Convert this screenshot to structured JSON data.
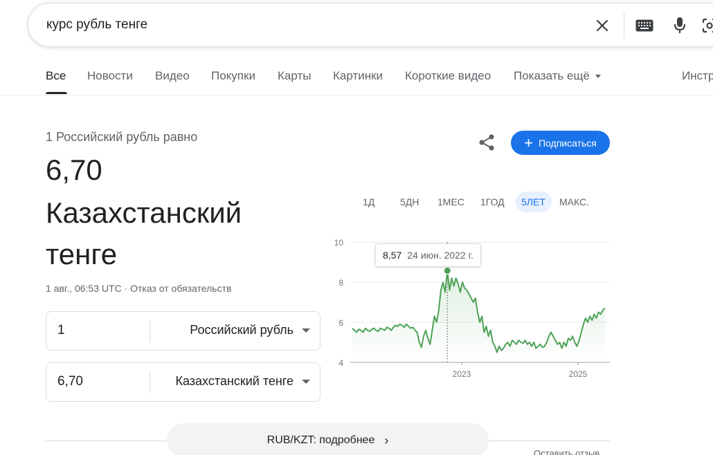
{
  "search": {
    "query": "курс рубль тенге"
  },
  "tabs": [
    {
      "label": "Все"
    },
    {
      "label": "Новости"
    },
    {
      "label": "Видео"
    },
    {
      "label": "Покупки"
    },
    {
      "label": "Карты"
    },
    {
      "label": "Картинки"
    },
    {
      "label": "Короткие видео"
    },
    {
      "label": "Показать ещё"
    },
    {
      "label": "Инстр"
    }
  ],
  "result": {
    "equals_text": "1 Российский рубль равно",
    "value": "6,70",
    "currency_name": "Казахстанский тенге",
    "timestamp": "1 авг., 06:53 UTC · Отказ от обязательств"
  },
  "converter": {
    "from": {
      "amount": "1",
      "currency": "Российский рубль"
    },
    "to": {
      "amount": "6,70",
      "currency": "Казахстанский тенге"
    }
  },
  "actions": {
    "subscribe_label": "Подписаться"
  },
  "ranges": [
    "1Д",
    "5ДН",
    "1МЕС",
    "1ГОД",
    "5ЛЕТ",
    "МАКС."
  ],
  "active_range": "5ЛЕТ",
  "tooltip": {
    "value": "8,57",
    "date": "24 июн. 2022 г."
  },
  "chart_data": {
    "type": "line",
    "ylim": [
      4,
      10
    ],
    "yticks": [
      "4",
      "6",
      "8",
      "10"
    ],
    "xticks": [
      "2023",
      "2025"
    ],
    "grid": true,
    "color": "#4ca256",
    "series": [
      {
        "values": [
          5.7,
          5.6,
          5.5,
          5.65,
          5.6,
          5.5,
          5.7,
          5.6,
          5.55,
          5.65,
          5.7,
          5.6,
          5.55,
          5.7,
          5.65,
          5.6,
          5.75,
          5.7,
          5.6,
          5.75,
          5.85,
          5.8,
          5.9,
          5.85,
          5.75,
          5.9,
          5.8,
          5.7,
          5.75,
          5.6,
          5.5,
          5.0,
          4.75,
          5.3,
          5.6,
          5.2,
          4.9,
          5.6,
          6.3,
          6.0,
          6.6,
          7.6,
          8.0,
          7.5,
          8.57,
          7.6,
          8.2,
          7.8,
          8.2,
          7.9,
          7.5,
          8.0,
          7.7,
          7.6,
          7.4,
          7.2,
          7.0,
          7.2,
          6.5,
          6.0,
          6.3,
          5.5,
          5.8,
          5.3,
          5.6,
          5.0,
          4.8,
          4.5,
          4.8,
          4.6,
          4.7,
          4.9,
          5.0,
          4.8,
          5.1,
          5.0,
          4.9,
          5.1,
          5.0,
          4.95,
          5.1,
          4.9,
          5.0,
          4.8,
          5.0,
          4.7,
          4.8,
          4.9,
          4.75,
          4.8,
          5.0,
          5.3,
          5.5,
          5.3,
          5.1,
          4.9,
          5.0,
          4.7,
          5.0,
          4.8,
          5.2,
          5.1,
          5.3,
          5.0,
          4.8,
          5.1,
          5.5,
          5.9,
          6.2,
          6.0,
          6.3,
          6.1,
          6.4,
          6.2,
          6.5,
          6.4,
          6.6,
          6.7
        ]
      }
    ],
    "highlight": {
      "value": 8.57,
      "date": "24 июн. 2022 г."
    }
  },
  "more": {
    "label": "RUB/KZT: подробнее"
  },
  "feedback": {
    "label": "Оставить отзыв"
  }
}
